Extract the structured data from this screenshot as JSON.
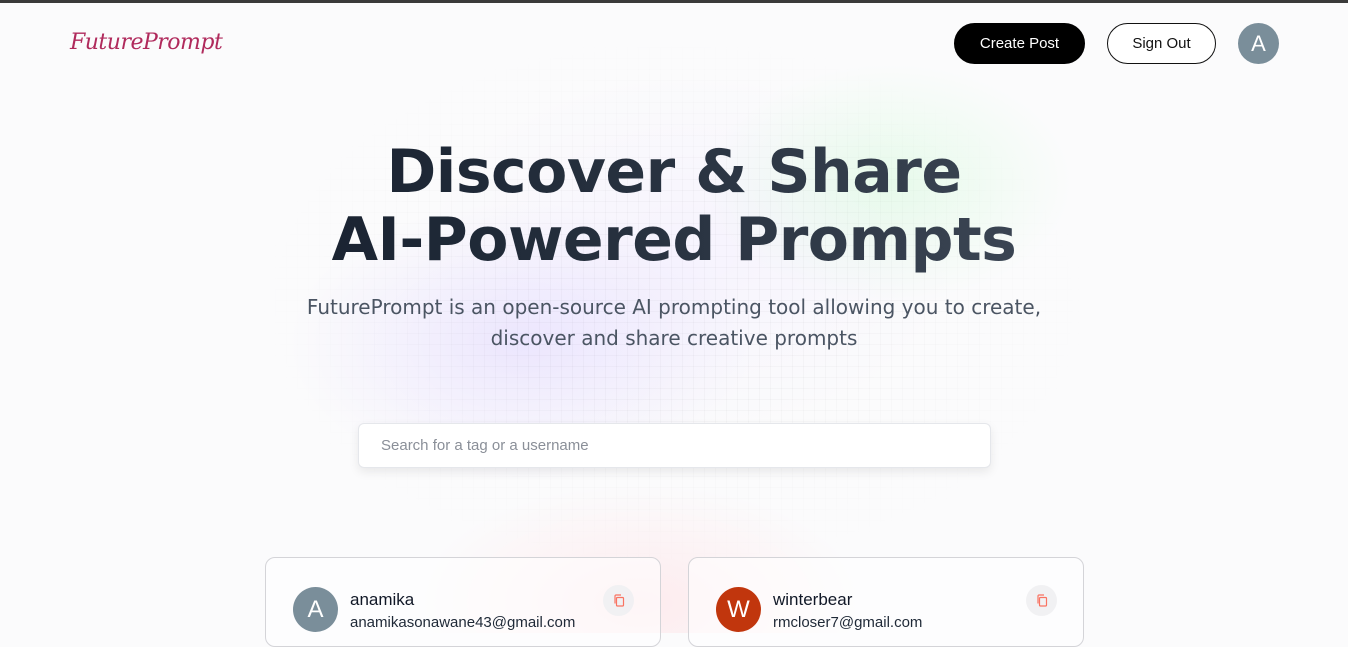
{
  "nav": {
    "logo": "FuturePrompt",
    "create_post": "Create Post",
    "sign_out": "Sign Out",
    "avatar_initial": "A"
  },
  "hero": {
    "line1": "Discover & Share",
    "line2": "AI-Powered Prompts",
    "desc_line1": "FuturePrompt is an open-source AI prompting tool allowing you to create,",
    "desc_line2": "discover and share creative prompts"
  },
  "search": {
    "placeholder": "Search for a tag or a username",
    "value": ""
  },
  "cards": [
    {
      "initial": "A",
      "username": "anamika",
      "email": "anamikasonawane43@gmail.com",
      "avatar_color": "#7a8e9a",
      "icon": "copy-icon"
    },
    {
      "initial": "W",
      "username": "winterbear",
      "email": "rmcloser7@gmail.com",
      "avatar_color": "#c1360d",
      "icon": "copy-icon"
    }
  ],
  "colors": {
    "logo": "#b02a5c",
    "accent_button": "#000000",
    "copy_icon": "#f97362"
  }
}
